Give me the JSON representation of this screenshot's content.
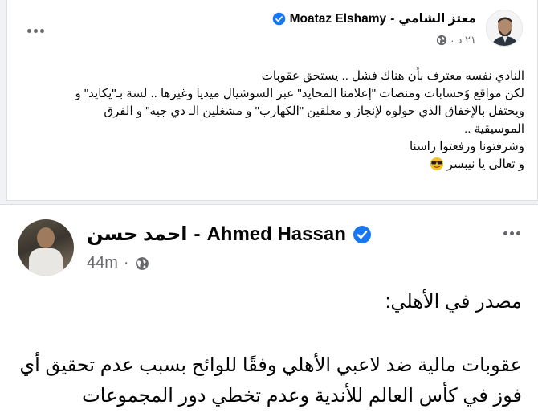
{
  "post1": {
    "author_ar": "معتز الشامي",
    "separator": "-",
    "author_en": "Moataz Elshamy",
    "time": "٢١ د",
    "body_lines": [
      "النادي نفسه معترف بأن هناك فشل .. يستحق عقوبات",
      "لكن مواقع وًحسابات ومنصات \"إعلامنا المحايد\" عبر السوشيال ميديا وغيرها .. لسة بـ\"يكايد\" و",
      "ويحتفل بالإخفاق الذي حولوه لإنجاز و معلقين \"الكهارب\" و مشغلين الـ دي جيه\" و الفرق",
      "الموسيقية ..",
      "وشرفتونا ورفعتوا راسنا",
      "و تعالى يا نيبسر"
    ],
    "emoji": "sunglasses-emoji"
  },
  "post2": {
    "author_ar": "احمد حسن",
    "separator": "-",
    "author_en": "Ahmed Hassan",
    "time": "44m",
    "body_lines": [
      "مصدر في الأهلي:",
      "عقوبات مالية ضد لاعبي الأهلي وفقًا للوائح بسبب عدم تحقيق أي",
      "فوز في كأس العالم للأندية وعدم تخطي دور المجموعات"
    ]
  },
  "colors": {
    "verified": "#1877f2",
    "meta_text": "#65676b",
    "background": "#f0f2f5"
  },
  "icons": [
    "verified-badge-icon",
    "globe-icon",
    "more-options-icon",
    "sunglasses-emoji"
  ]
}
